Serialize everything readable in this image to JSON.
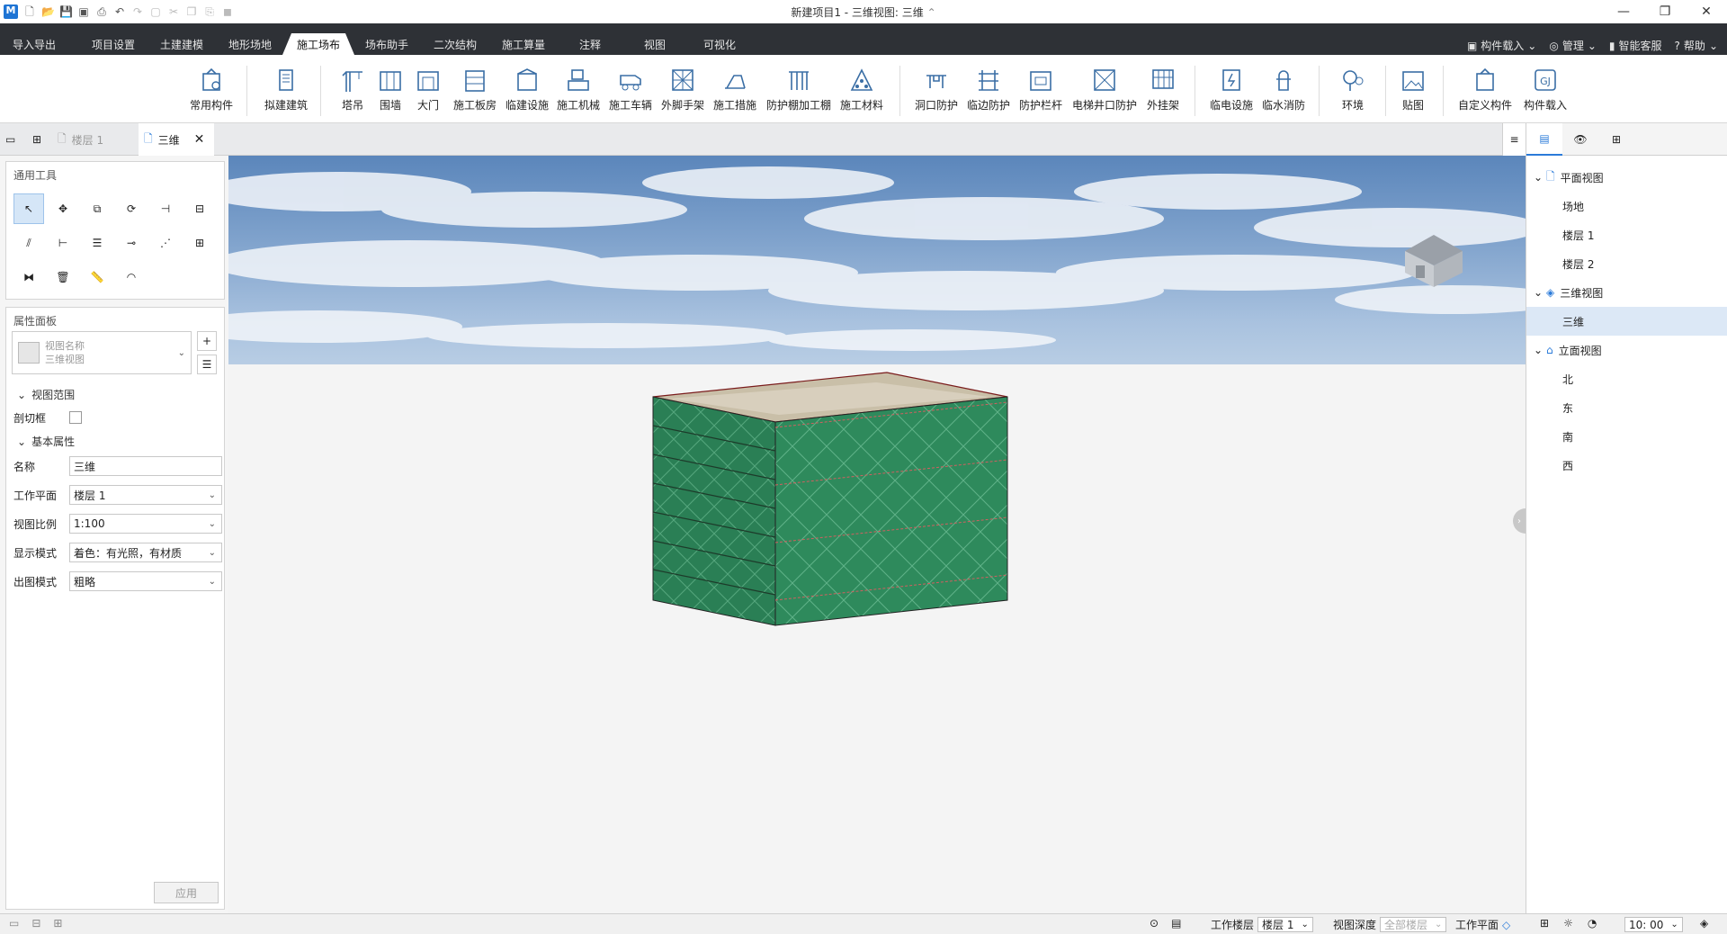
{
  "window": {
    "title": "新建项目1 - 三维视图: 三维",
    "title_suffix": "⌃",
    "controls": [
      "minimize",
      "restore",
      "close"
    ]
  },
  "quick_access": [
    "app-logo",
    "new-icon",
    "open-icon",
    "save-icon",
    "save-all-icon",
    "export-icon",
    "undo-icon",
    "redo-icon",
    "select-icon",
    "cut-icon",
    "copy-icon",
    "paste-icon",
    "match-icon"
  ],
  "menu_tabs": [
    {
      "label": "导入导出"
    },
    {
      "label": "项目设置"
    },
    {
      "label": "土建建模"
    },
    {
      "label": "地形场地"
    },
    {
      "label": "施工场布",
      "active": true
    },
    {
      "label": "场布助手"
    },
    {
      "label": "二次结构"
    },
    {
      "label": "施工算量"
    },
    {
      "label": "注释"
    },
    {
      "label": "视图"
    },
    {
      "label": "可视化"
    }
  ],
  "top_right": {
    "component_load": "构件载入",
    "manage": "管理",
    "smart_service": "智能客服",
    "help": "帮助"
  },
  "ribbon": {
    "common": "常用构件",
    "proposed": "拟建建筑",
    "tower_crane": "塔吊",
    "fence": "围墙",
    "gate": "大门",
    "board_house": "施工板房",
    "temp_facility": "临建设施",
    "machinery": "施工机械",
    "vehicle": "施工车辆",
    "ext_scaffold": "外脚手架",
    "measures": "施工措施",
    "protect_shed": "防护棚加工棚",
    "material": "施工材料",
    "hole_protect": "洞口防护",
    "edge_protect": "临边防护",
    "guardrail": "防护栏杆",
    "elevator_protect": "电梯井口防护",
    "hanging_frame": "外挂架",
    "temp_power": "临电设施",
    "temp_water": "临水消防",
    "environment": "环境",
    "decal": "贴图",
    "custom": "自定义构件",
    "comp_load": "构件载入"
  },
  "doc_tabs": {
    "floor1": "楼层 1",
    "three_d": "三维"
  },
  "tools": {
    "title": "通用工具"
  },
  "properties": {
    "title": "属性面板",
    "view_name_label": "视图名称",
    "view_name_value": "三维视图",
    "section_range": "视图范围",
    "cut_box": "剖切框",
    "cut_box_checked": false,
    "section_basic": "基本属性",
    "name_label": "名称",
    "name_value": "三维",
    "workplane_label": "工作平面",
    "workplane_value": "楼层 1",
    "scale_label": "视图比例",
    "scale_value": "1:100",
    "display_label": "显示模式",
    "display_value": "着色：有光照，有材质",
    "output_label": "出图模式",
    "output_value": "粗略",
    "apply": "应用"
  },
  "browser": {
    "plan": "平面视图",
    "site": "场地",
    "floor1": "楼层 1",
    "floor2": "楼层 2",
    "three_d_view": "三维视图",
    "three_d": "三维",
    "elevation": "立面视图",
    "north": "北",
    "east": "东",
    "south": "南",
    "west": "西"
  },
  "status": {
    "work_floor_label": "工作楼层",
    "work_floor_value": "楼层 1",
    "view_depth_label": "视图深度",
    "view_depth_value": "全部楼层",
    "work_plane": "工作平面",
    "time": "10: 00"
  },
  "colors": {
    "accent": "#2b7bd9",
    "tabbar": "#2e3136",
    "net_green": "#2e8a5c"
  }
}
